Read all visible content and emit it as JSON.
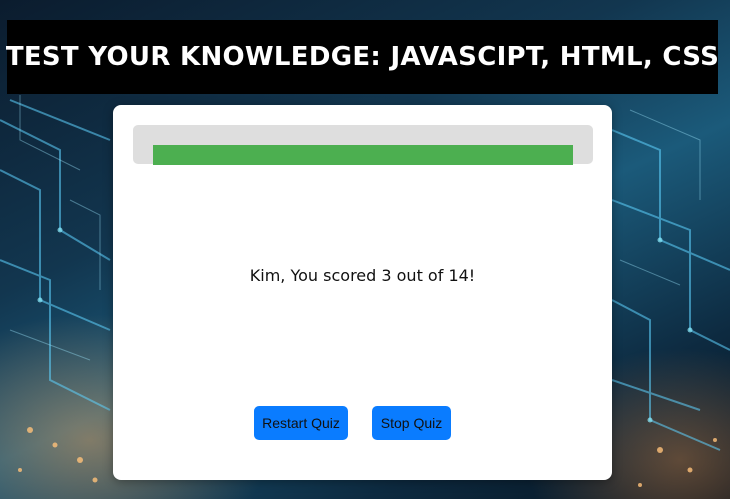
{
  "header": {
    "title": "TEST YOUR KNOWLEDGE: JAVASCIPT, HTML, CSS"
  },
  "quiz": {
    "progress_fraction": 1.0,
    "result_text": "Kim, You scored 3 out of 14!"
  },
  "buttons": {
    "restart_label": "Restart Quiz",
    "stop_label": "Stop Quiz"
  },
  "colors": {
    "title_bar": "#000000",
    "progress_track": "#dedede",
    "progress_fill": "#4caf50",
    "button": "#0a7cff"
  }
}
